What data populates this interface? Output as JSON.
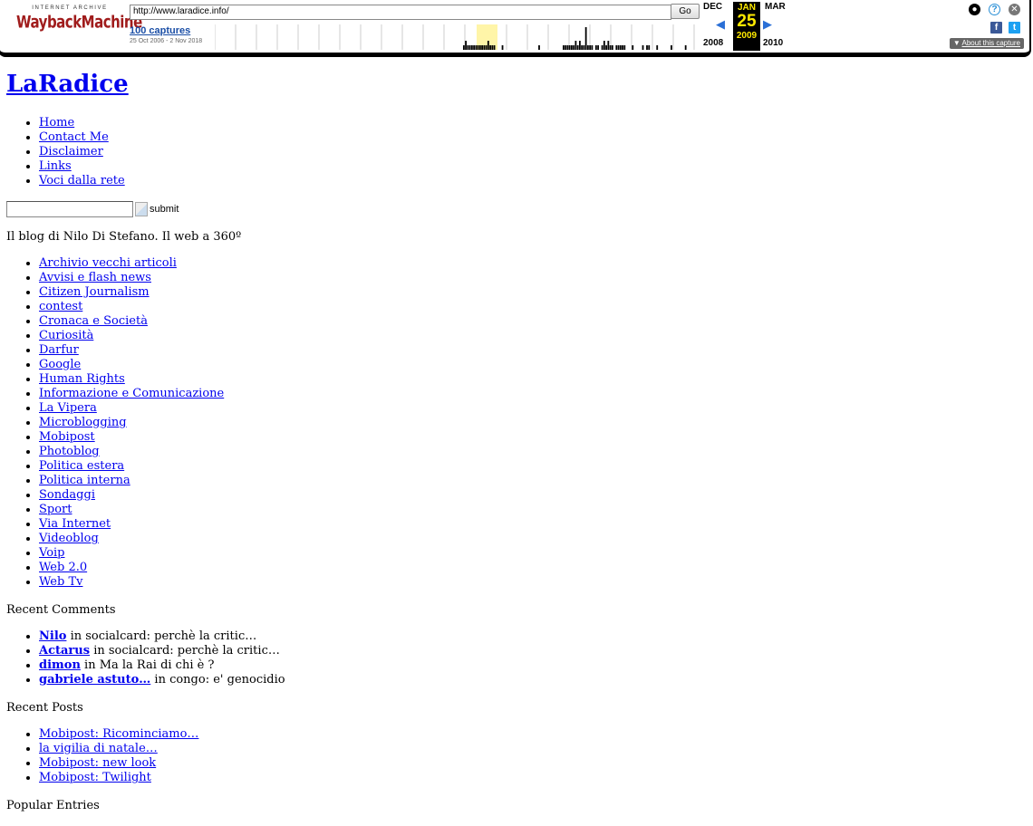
{
  "wayback": {
    "logo_top": "INTERNET ARCHIVE",
    "logo_wayback": "WaybackMachine",
    "url": "http://www.laradice.info/",
    "go_label": "Go",
    "captures": "100 captures",
    "range": "25 Oct 2006 - 2 Nov 2018",
    "prev_month": "DEC",
    "cur_month": "JAN",
    "next_month": "MAR",
    "day": "25",
    "prev_year": "2008",
    "cur_year": "2009",
    "next_year": "2010",
    "about": "About this capture",
    "sparkline": [
      0,
      0,
      0,
      0,
      0,
      0,
      0,
      0,
      0,
      0,
      0,
      0,
      0,
      0,
      0,
      0,
      0,
      0,
      0,
      0,
      0,
      0,
      0,
      0,
      0,
      0,
      0,
      0,
      0,
      0,
      0,
      0,
      0,
      0,
      0,
      0,
      0,
      0,
      0,
      0,
      0,
      0,
      0,
      0,
      0,
      0,
      0,
      0,
      0,
      0,
      0,
      0,
      0,
      0,
      0,
      0,
      0,
      0,
      0,
      0,
      0,
      0,
      0,
      0,
      0,
      0,
      0,
      0,
      0,
      0,
      0,
      0,
      0,
      0,
      0,
      0,
      0,
      0,
      0,
      0,
      0,
      0,
      0,
      0,
      0,
      0,
      0,
      0,
      0,
      0,
      0,
      0,
      0,
      0,
      0,
      0,
      0,
      0,
      0,
      0,
      0,
      0,
      0,
      0,
      0,
      0,
      0,
      0,
      0,
      0,
      0,
      0,
      0,
      0,
      0,
      0,
      0,
      0,
      0,
      0,
      0,
      0,
      1,
      2,
      1,
      1,
      1,
      1,
      1,
      1,
      1,
      1,
      1,
      1,
      2,
      1,
      1,
      1,
      0,
      0,
      0,
      1,
      0,
      0,
      0,
      0,
      0,
      0,
      0,
      0,
      0,
      0,
      0,
      0,
      0,
      0,
      0,
      0,
      0,
      1,
      0,
      0,
      0,
      0,
      0,
      0,
      0,
      0,
      0,
      0,
      0,
      1,
      1,
      1,
      1,
      1,
      1,
      2,
      1,
      2,
      1,
      1,
      5,
      1,
      1,
      1,
      0,
      1,
      1,
      0,
      1,
      2,
      1,
      2,
      1,
      1,
      0,
      1,
      1,
      1,
      1,
      1,
      0,
      0,
      0,
      1,
      0,
      0,
      0,
      0,
      1,
      0,
      1,
      1,
      0,
      0,
      0,
      1,
      0,
      0,
      0,
      0,
      0,
      0,
      1,
      0,
      0,
      0,
      0,
      0,
      0,
      1,
      0,
      0,
      0,
      0
    ]
  },
  "site": {
    "title": "LaRadice",
    "nav": [
      "Home",
      "Contact Me",
      "Disclaimer",
      "Links",
      "Voci dalla rete"
    ],
    "submit_alt": "submit",
    "tagline": "Il blog di Nilo Di Stefano. Il web a 360º",
    "categories": [
      "Archivio vecchi articoli",
      "Avvisi e flash news",
      "Citizen Journalism",
      "contest",
      "Cronaca e Società",
      "Curiosità",
      "Darfur",
      "Google",
      "Human Rights",
      "Informazione e Comunicazione",
      "La Vipera",
      "Microblogging",
      "Mobipost",
      "Photoblog",
      "Politica estera",
      "Politica interna",
      "Sondaggi",
      "Sport",
      "Via Internet",
      "Videoblog",
      "Voip",
      "Web 2.0",
      "Web Tv"
    ],
    "recent_comments_title": "Recent Comments",
    "recent_comments": [
      {
        "author": "Nilo",
        "text": " in socialcard: perchè la critic…"
      },
      {
        "author": "Actarus",
        "text": " in socialcard: perchè la critic…"
      },
      {
        "author": "dimon",
        "text": " in Ma la Rai di chi è ?"
      },
      {
        "author": "gabriele astuto…",
        "text": " in congo: e' genocidio"
      }
    ],
    "recent_posts_title": "Recent Posts",
    "recent_posts": [
      "Mobipost: Ricominciamo…",
      "la vigilia di natale…",
      "Mobipost: new look",
      "Mobipost: Twilight"
    ],
    "popular_title": "Popular Entries"
  }
}
